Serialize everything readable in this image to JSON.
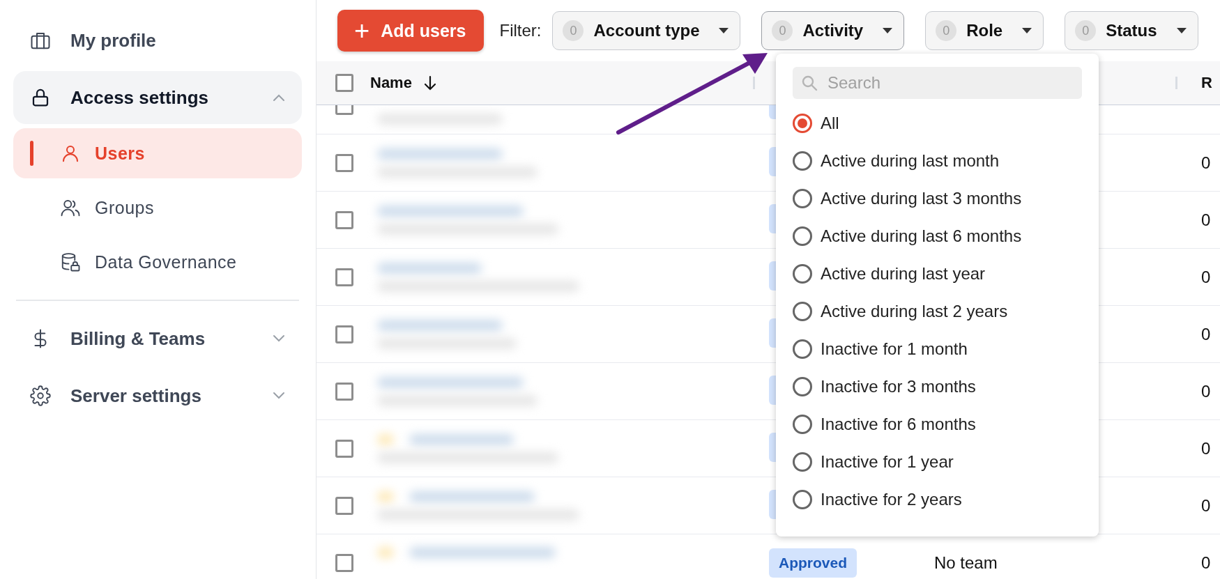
{
  "sidebar": {
    "items": [
      {
        "label": "My profile",
        "kind": "profile",
        "expanded": false,
        "has_toggle": false
      },
      {
        "label": "Access settings",
        "kind": "access",
        "expanded": true,
        "has_toggle": true,
        "children": [
          {
            "label": "Users",
            "kind": "users",
            "selected": true
          },
          {
            "label": "Groups",
            "kind": "groups",
            "selected": false
          },
          {
            "label": "Data Governance",
            "kind": "governance",
            "selected": false
          }
        ]
      },
      {
        "label": "Billing & Teams",
        "kind": "billing",
        "expanded": false,
        "has_toggle": true,
        "divider_before": true
      },
      {
        "label": "Server settings",
        "kind": "server",
        "expanded": false,
        "has_toggle": true
      }
    ]
  },
  "toolbar": {
    "add_button": "Add users",
    "add_icon": "+",
    "filter_label": "Filter:",
    "filters": [
      {
        "count": "0",
        "label": "Account type",
        "open": false
      },
      {
        "count": "0",
        "label": "Activity",
        "open": true
      },
      {
        "count": "0",
        "label": "Role",
        "open": false
      },
      {
        "count": "0",
        "label": "Status",
        "open": false
      }
    ]
  },
  "table": {
    "select_all_checked": false,
    "columns": [
      {
        "label": "Name",
        "sorted": true
      },
      {
        "label": "R"
      }
    ],
    "rows": [
      {
        "checked": false
      },
      {
        "checked": false,
        "avatar": false,
        "column_5": "0"
      },
      {
        "checked": false,
        "avatar": false,
        "column_5": "0"
      },
      {
        "checked": false,
        "avatar": false,
        "column_5": "0"
      },
      {
        "checked": false,
        "avatar": false,
        "column_5": "0"
      },
      {
        "checked": false,
        "avatar": false,
        "column_5": "0"
      },
      {
        "checked": false,
        "avatar": true,
        "column_5": "0"
      },
      {
        "checked": false,
        "avatar": true,
        "column_5": "0"
      },
      {
        "checked": false,
        "avatar": true,
        "status": "Approved",
        "team": "No team",
        "column_5": "0"
      }
    ]
  },
  "activity_dropdown": {
    "search_placeholder": "Search",
    "options": [
      {
        "label": "All",
        "selected": true
      },
      {
        "label": "Active during last month",
        "selected": false
      },
      {
        "label": "Active during last 3 months",
        "selected": false
      },
      {
        "label": "Active during last 6 months",
        "selected": false
      },
      {
        "label": "Active during last year",
        "selected": false
      },
      {
        "label": "Active during last 2 years",
        "selected": false
      },
      {
        "label": "Inactive for 1 month",
        "selected": false
      },
      {
        "label": "Inactive for 3 months",
        "selected": false
      },
      {
        "label": "Inactive for 6 months",
        "selected": false
      },
      {
        "label": "Inactive for 1 year",
        "selected": false
      },
      {
        "label": "Inactive for 2 years",
        "selected": false
      }
    ]
  },
  "annotation": {
    "kind": "arrow",
    "color": "#5f1e8a"
  }
}
